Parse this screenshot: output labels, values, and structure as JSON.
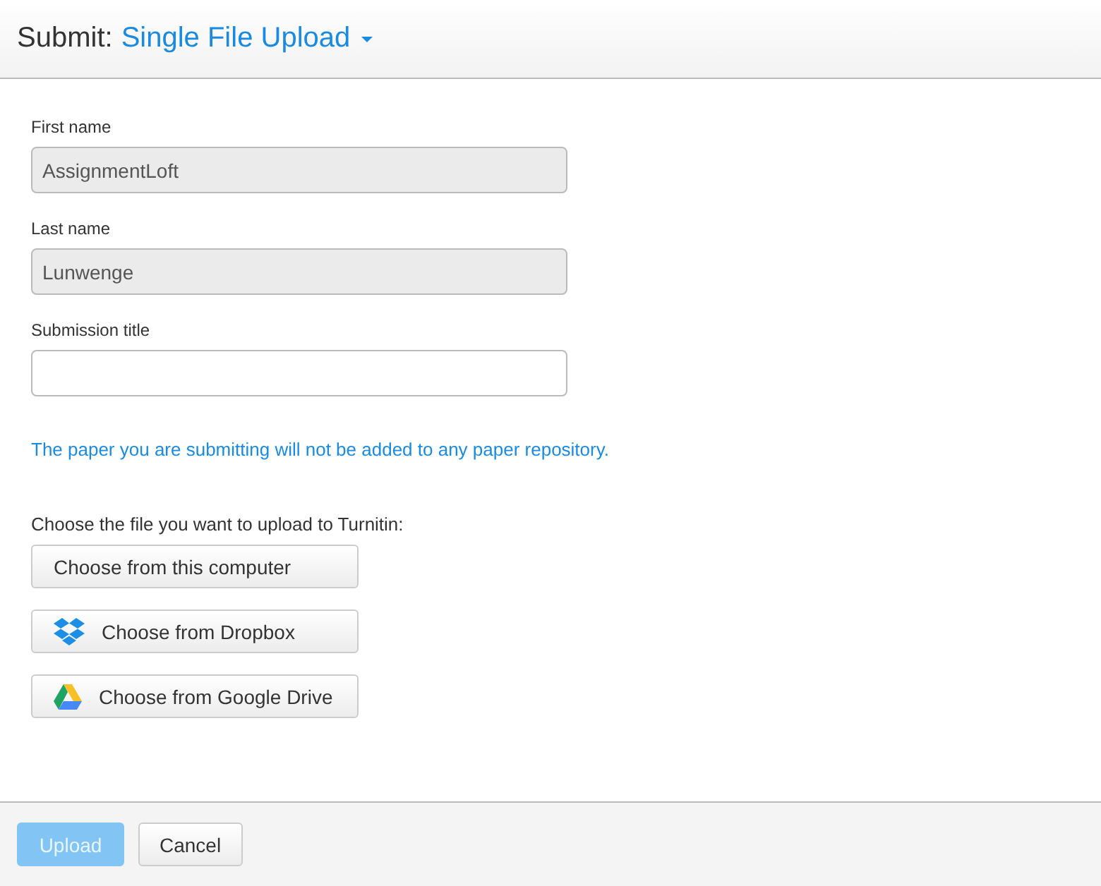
{
  "header": {
    "prefix": "Submit:",
    "mode": "Single File Upload"
  },
  "fields": [
    {
      "label": "First name",
      "value": "AssignmentLoft",
      "disabled": true
    },
    {
      "label": "Last name",
      "value": "Lunwenge",
      "disabled": true
    },
    {
      "label": "Submission title",
      "disabled": false
    }
  ],
  "notice": "The paper you are submitting will not be added to any paper repository.",
  "file_prompt": "Choose the file you want to upload to Turnitin:",
  "sources": [
    {
      "kind": "computer",
      "label": "Choose from this computer"
    },
    {
      "kind": "dropbox",
      "label": "Choose from Dropbox"
    },
    {
      "kind": "drive",
      "label": "Choose from Google Drive"
    }
  ],
  "footer": [
    {
      "kind": "primary",
      "label": "Upload",
      "disabled": true
    },
    {
      "kind": "default",
      "label": "Cancel",
      "disabled": false
    }
  ]
}
